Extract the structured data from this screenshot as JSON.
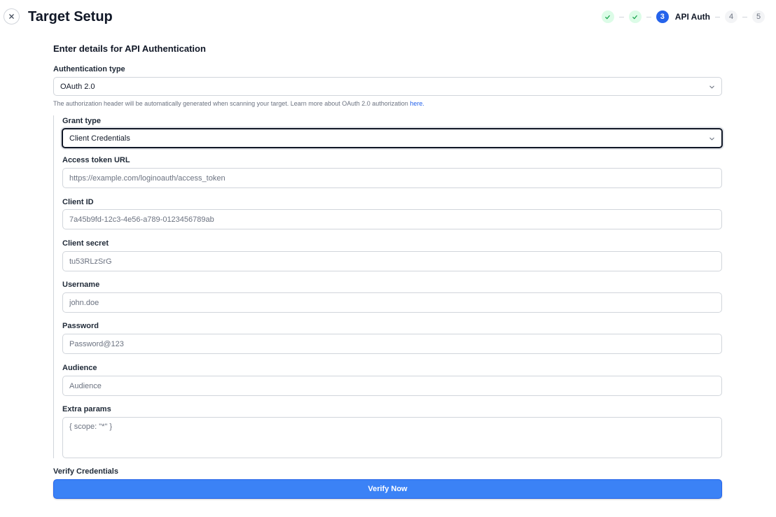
{
  "header": {
    "title": "Target Setup",
    "close_icon": "close-icon"
  },
  "stepper": {
    "completed_icon": "check-icon",
    "active_step": "3",
    "active_label": "API Auth",
    "future_steps": [
      "4",
      "5"
    ],
    "colors": {
      "done_bg": "#dcfce7",
      "done_check": "#16a34a",
      "active": "#2563eb"
    }
  },
  "form": {
    "section_title": "Enter details for API Authentication",
    "auth_type": {
      "label": "Authentication type",
      "value": "OAuth 2.0"
    },
    "help_text": "The authorization header will be automatically generated when scanning your target. Learn more about OAuth 2.0 authorization ",
    "help_link": "here.",
    "grant_type": {
      "label": "Grant type",
      "value": "Client Credentials"
    },
    "access_token_url": {
      "label": "Access token URL",
      "placeholder": "https://example.com/loginoauth/access_token"
    },
    "client_id": {
      "label": "Client ID",
      "placeholder": "7a45b9fd-12c3-4e56-a789-0123456789ab"
    },
    "client_secret": {
      "label": "Client secret",
      "placeholder": "tu53RLzSrG"
    },
    "username": {
      "label": "Username",
      "placeholder": "john.doe"
    },
    "password": {
      "label": "Password",
      "placeholder": "Password@123"
    },
    "audience": {
      "label": "Audience",
      "placeholder": "Audience"
    },
    "extra_params": {
      "label": "Extra params",
      "placeholder": "{ scope: \"*\" }"
    }
  },
  "verify": {
    "label": "Verify Credentials",
    "button": "Verify Now",
    "button_color": "#3b82f6"
  }
}
